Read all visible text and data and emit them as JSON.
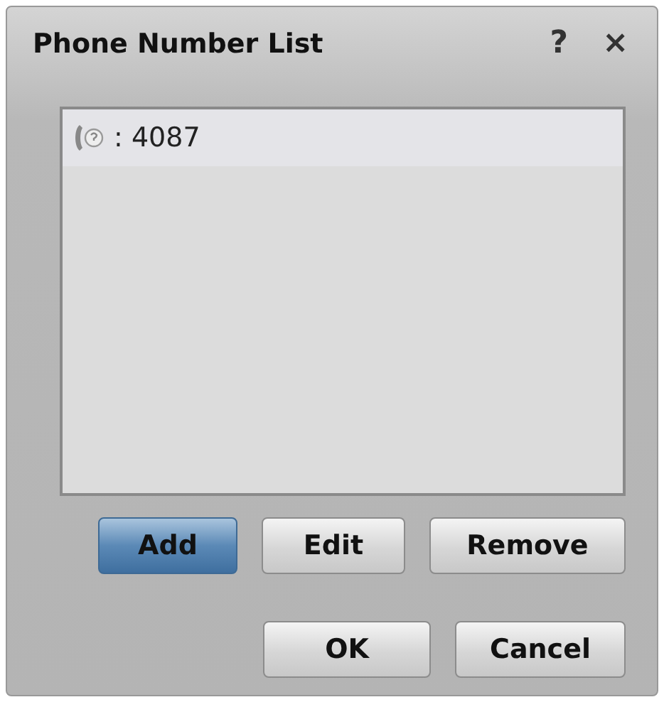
{
  "window": {
    "title": "Phone Number List",
    "help": "?",
    "close": "×"
  },
  "numbers": [
    {
      "label": ": 4087",
      "selected": true
    }
  ],
  "list_buttons": [
    {
      "label": "Add",
      "focused": true
    },
    {
      "label": "Edit",
      "focused": false
    },
    {
      "label": "Remove",
      "focused": false
    }
  ],
  "dialog_buttons": [
    {
      "label": "OK",
      "focused": false
    },
    {
      "label": "Cancel",
      "focused": false
    }
  ]
}
